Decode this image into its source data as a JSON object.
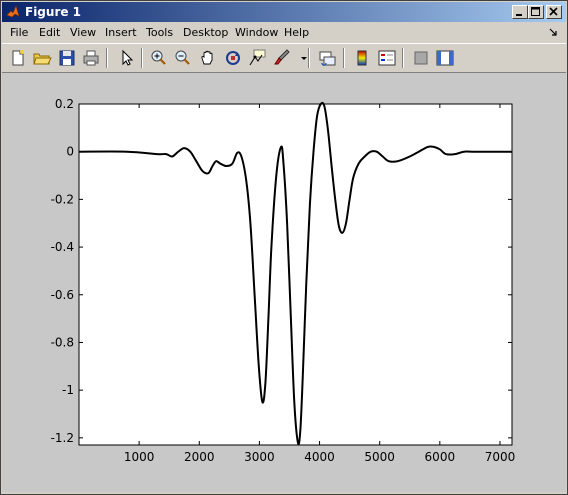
{
  "window": {
    "title": "Figure 1"
  },
  "menu": [
    "File",
    "Edit",
    "View",
    "Insert",
    "Tools",
    "Desktop",
    "Window",
    "Help"
  ],
  "toolbar": {
    "icons": [
      "new-figure-icon",
      "open-file-icon",
      "save-icon",
      "print-icon",
      "pointer-icon",
      "zoom-in-icon",
      "zoom-out-icon",
      "pan-hand-icon",
      "rotate-3d-icon",
      "data-cursor-icon",
      "brush-icon",
      "link-plot-icon",
      "colorbar-icon",
      "legend-icon",
      "hide-plot-tools-icon",
      "show-plot-tools-icon"
    ]
  },
  "chart_data": {
    "type": "line",
    "xlim": [
      0,
      7200
    ],
    "ylim": [
      -1.23,
      0.2
    ],
    "xticks": [
      1000,
      2000,
      3000,
      4000,
      5000,
      6000,
      7000
    ],
    "xtick_labels": [
      "1000",
      "2000",
      "3000",
      "4000",
      "5000",
      "6000",
      "7000"
    ],
    "yticks": [
      0.2,
      0,
      -0.2,
      -0.4,
      -0.6,
      -0.8,
      -1,
      -1.2
    ],
    "ytick_labels": [
      "0.2",
      "0",
      "-0.2",
      "-0.4",
      "-0.6",
      "-0.8",
      "-1",
      "-1.2"
    ],
    "line_color": "#000000",
    "series": [
      {
        "x": [
          0,
          800,
          1300,
          1450,
          1550,
          1650,
          1750,
          1850,
          1950,
          2050,
          2150,
          2220,
          2280,
          2350,
          2450,
          2550,
          2630,
          2700,
          2780,
          2850,
          2920,
          2990,
          3050,
          3100,
          3150,
          3200,
          3280,
          3360,
          3400,
          3460,
          3520,
          3580,
          3640,
          3680,
          3720,
          3780,
          3840,
          3900,
          3960,
          4020,
          4080,
          4140,
          4200,
          4260,
          4320,
          4380,
          4440,
          4500,
          4560,
          4650,
          4750,
          4850,
          4950,
          5050,
          5150,
          5300,
          5500,
          5650,
          5800,
          5900,
          6000,
          6100,
          6250,
          6400,
          6550,
          7200
        ],
        "y": [
          0,
          0,
          -0.01,
          -0.01,
          -0.02,
          0.0,
          0.015,
          0.0,
          -0.04,
          -0.08,
          -0.09,
          -0.06,
          -0.04,
          -0.05,
          -0.06,
          -0.05,
          -0.005,
          -0.02,
          -0.12,
          -0.3,
          -0.6,
          -0.9,
          -1.05,
          -0.97,
          -0.7,
          -0.4,
          -0.1,
          0.02,
          -0.05,
          -0.3,
          -0.68,
          -1.05,
          -1.22,
          -1.17,
          -0.95,
          -0.55,
          -0.22,
          0.0,
          0.15,
          0.2,
          0.19,
          0.09,
          -0.06,
          -0.2,
          -0.31,
          -0.34,
          -0.3,
          -0.2,
          -0.11,
          -0.05,
          -0.02,
          0.0,
          0.0,
          -0.02,
          -0.04,
          -0.04,
          -0.02,
          0.0,
          0.02,
          0.02,
          0.01,
          -0.01,
          -0.01,
          0.0,
          0.0,
          0.0
        ]
      }
    ]
  }
}
